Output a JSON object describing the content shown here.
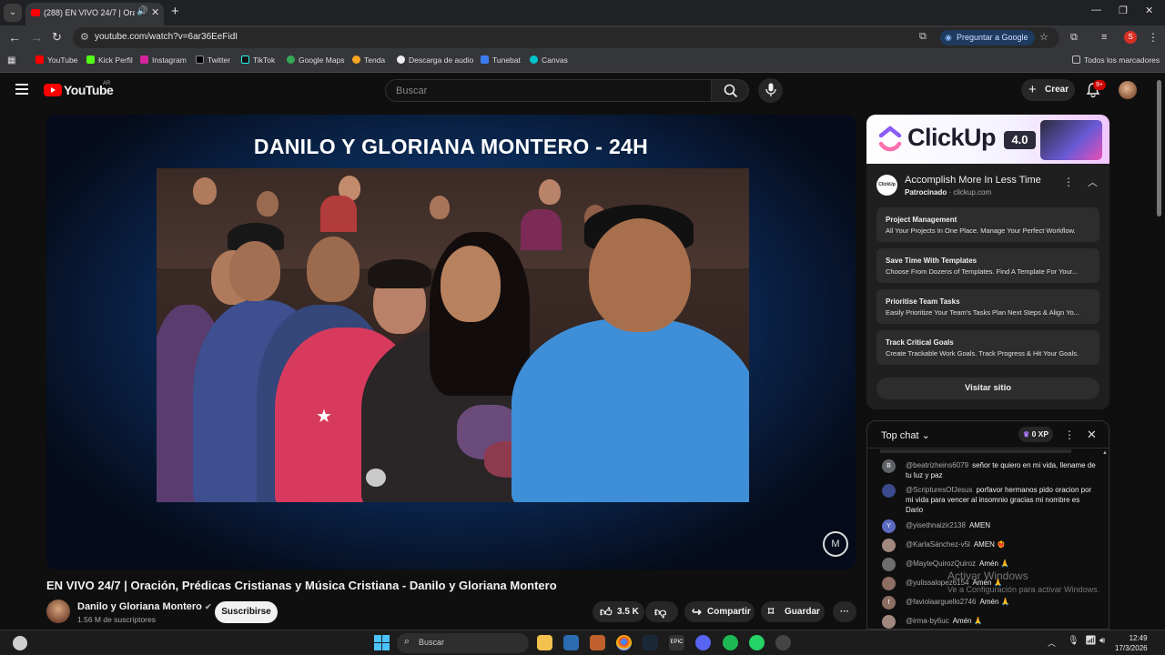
{
  "browser": {
    "tab_title": "(288) EN VIVO 24/7 | Oración...",
    "url": "youtube.com/watch?v=6ar36EeFidI",
    "ask_google": "Preguntar a Google",
    "profile_initial": "S",
    "all_bookmarks": "Todos los marcadores",
    "bookmarks": [
      "YouTube",
      "Kick Perfil",
      "Instagram",
      "Twitter",
      "TikTok",
      "Google Maps",
      "Tenda",
      "Descarga de audio",
      "Tunebat",
      "Canvas"
    ]
  },
  "youtube": {
    "logo_text": "YouTube",
    "country": "AR",
    "search_placeholder": "Buscar",
    "create_label": "Crear",
    "notif_count": "9+"
  },
  "video": {
    "overlay_title": "DANILO Y GLORIANA MONTERO - 24H",
    "title": "EN VIVO 24/7 | Oración, Prédicas Cristianas y Música Cristiana - Danilo y Gloriana Montero",
    "channel": "Danilo y Gloriana Montero",
    "subscribers": "1.56 M de suscriptores",
    "subscribe_label": "Suscribirse",
    "likes": "3.5 K",
    "share_label": "Compartir",
    "save_label": "Guardar"
  },
  "ad": {
    "brand": "ClickUp",
    "version": "4.0",
    "title": "Accomplish More In Less Time",
    "sponsored": "Patrocinado",
    "domain": "clickup.com",
    "cards": [
      {
        "title": "Project Management",
        "desc": "All Your Projects In One Place. Manage Your Perfect Workflow."
      },
      {
        "title": "Save Time With Templates",
        "desc": "Choose From Dozens of Templates. Find A Template For Your..."
      },
      {
        "title": "Prioritise Team Tasks",
        "desc": "Easily Prioritize Your Team's Tasks Plan Next Steps & Align Yo..."
      },
      {
        "title": "Track Critical Goals",
        "desc": "Create Trackable Work Goals. Track Progress & Hit Your Goals."
      }
    ],
    "visit_label": "Visitar sitio"
  },
  "chat": {
    "title": "Top chat",
    "xp": "0 XP",
    "messages": [
      {
        "author": "@beatrizheins6079",
        "text": "señor te quiero en mi vida, llename de tu luz y paz",
        "initial": "B",
        "color": "#5f6368"
      },
      {
        "author": "@ScripturesOfJesus",
        "text": "porfavor hermanos pido oracion por mi vida para vencer al insomnio gracias mi nombre es Dario",
        "initial": "",
        "color": "#3b4a8c"
      },
      {
        "author": "@yisethnaizir2138",
        "text": "AMEN",
        "initial": "Y",
        "color": "#5c6bc0"
      },
      {
        "author": "@KarlaSánchez-v5l",
        "text": "AMEN ❤️‍🔥",
        "initial": "",
        "color": "#a1887f"
      },
      {
        "author": "@MayteQuirozQuiroz",
        "text": "Amén 🙏",
        "initial": "",
        "color": "#6d6d6d"
      },
      {
        "author": "@yulissalopez6154",
        "text": "Amén 🙏",
        "initial": "",
        "color": "#8d6e63"
      },
      {
        "author": "@faviolaarguello2746",
        "text": "Amén 🙏",
        "initial": "f",
        "color": "#8d6e63"
      },
      {
        "author": "@irma-by6uc",
        "text": "Amén 🙏",
        "initial": "",
        "color": "#a1887f"
      }
    ]
  },
  "windows": {
    "activate_title": "Activar Windows",
    "activate_sub": "Ve a Configuración para activar Windows.",
    "search_placeholder": "Buscar",
    "time": "12:49",
    "date": "17/3/2026"
  }
}
